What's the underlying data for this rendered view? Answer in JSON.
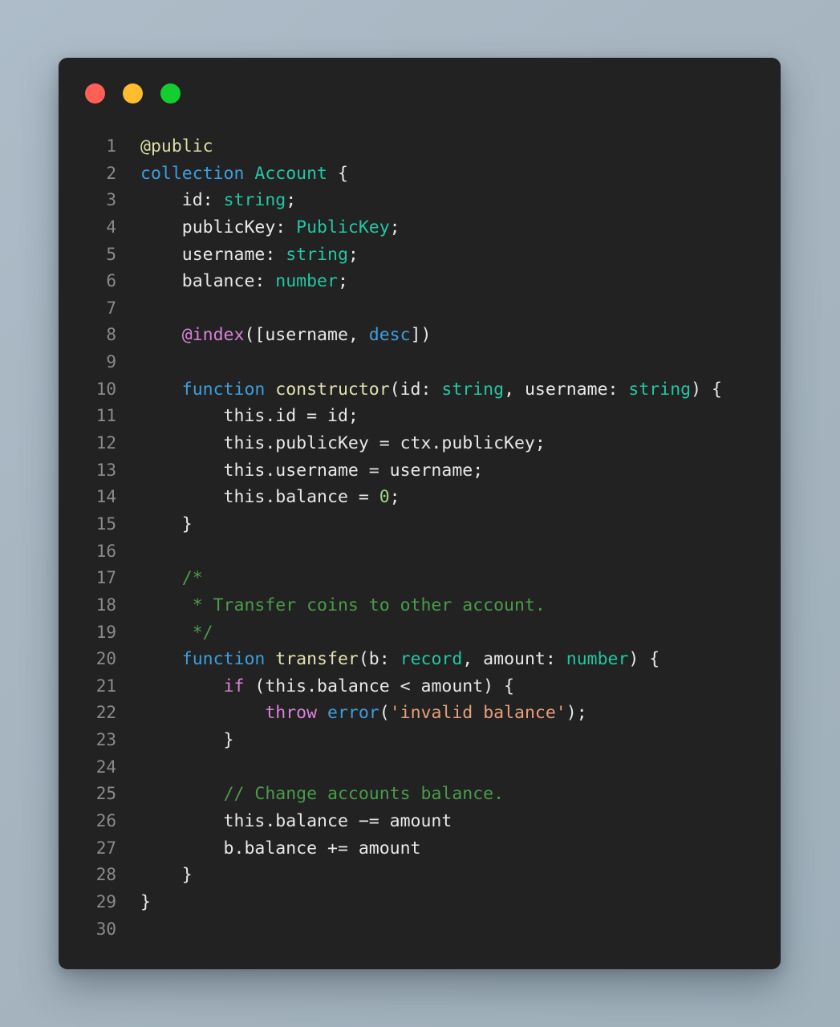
{
  "window": {
    "background_color": "#222222",
    "page_background_color": "#a8b6c2",
    "traffic_lights": [
      {
        "name": "close",
        "color": "#ff5f56"
      },
      {
        "name": "minimize",
        "color": "#ffbd2e"
      },
      {
        "name": "maximize",
        "color": "#13ce2f"
      }
    ]
  },
  "editor": {
    "language": "polylang",
    "total_lines": 30,
    "colors": {
      "plain": "#e8e8e8",
      "decorator": "#dcdcaa",
      "annotation": "#d782d9",
      "keyword": "#3d9ede",
      "control": "#d782d9",
      "type": "#23c6a4",
      "function": "#e2e2b0",
      "builtin": "#3d9ede",
      "string": "#e6a07a",
      "number": "#9fd18c",
      "comment": "#4a9c4a",
      "gutter": "#8b8b8b"
    },
    "lines": [
      {
        "num": "1",
        "tokens": [
          {
            "t": "@public",
            "c": "decor"
          }
        ]
      },
      {
        "num": "2",
        "tokens": [
          {
            "t": "collection ",
            "c": "keyword"
          },
          {
            "t": "Account",
            "c": "type"
          },
          {
            "t": " {",
            "c": "plain"
          }
        ]
      },
      {
        "num": "3",
        "tokens": [
          {
            "t": "    id: ",
            "c": "plain"
          },
          {
            "t": "string",
            "c": "type"
          },
          {
            "t": ";",
            "c": "plain"
          }
        ]
      },
      {
        "num": "4",
        "tokens": [
          {
            "t": "    publicKey: ",
            "c": "plain"
          },
          {
            "t": "PublicKey",
            "c": "type"
          },
          {
            "t": ";",
            "c": "plain"
          }
        ]
      },
      {
        "num": "5",
        "tokens": [
          {
            "t": "    username: ",
            "c": "plain"
          },
          {
            "t": "string",
            "c": "type"
          },
          {
            "t": ";",
            "c": "plain"
          }
        ]
      },
      {
        "num": "6",
        "tokens": [
          {
            "t": "    balance: ",
            "c": "plain"
          },
          {
            "t": "number",
            "c": "type"
          },
          {
            "t": ";",
            "c": "plain"
          }
        ]
      },
      {
        "num": "7",
        "tokens": []
      },
      {
        "num": "8",
        "tokens": [
          {
            "t": "    ",
            "c": "plain"
          },
          {
            "t": "@index",
            "c": "annot"
          },
          {
            "t": "([username, ",
            "c": "plain"
          },
          {
            "t": "desc",
            "c": "keyword"
          },
          {
            "t": "])",
            "c": "plain"
          }
        ]
      },
      {
        "num": "9",
        "tokens": []
      },
      {
        "num": "10",
        "tokens": [
          {
            "t": "    ",
            "c": "plain"
          },
          {
            "t": "function ",
            "c": "keyword"
          },
          {
            "t": "constructor",
            "c": "func"
          },
          {
            "t": "(id: ",
            "c": "plain"
          },
          {
            "t": "string",
            "c": "type"
          },
          {
            "t": ", username: ",
            "c": "plain"
          },
          {
            "t": "string",
            "c": "type"
          },
          {
            "t": ") {",
            "c": "plain"
          }
        ]
      },
      {
        "num": "11",
        "tokens": [
          {
            "t": "        this.id = id;",
            "c": "plain"
          }
        ]
      },
      {
        "num": "12",
        "tokens": [
          {
            "t": "        this.publicKey = ctx.publicKey;",
            "c": "plain"
          }
        ]
      },
      {
        "num": "13",
        "tokens": [
          {
            "t": "        this.username = username;",
            "c": "plain"
          }
        ]
      },
      {
        "num": "14",
        "tokens": [
          {
            "t": "        this.balance = ",
            "c": "plain"
          },
          {
            "t": "0",
            "c": "number"
          },
          {
            "t": ";",
            "c": "plain"
          }
        ]
      },
      {
        "num": "15",
        "tokens": [
          {
            "t": "    }",
            "c": "plain"
          }
        ]
      },
      {
        "num": "16",
        "tokens": []
      },
      {
        "num": "17",
        "tokens": [
          {
            "t": "    /*",
            "c": "comment"
          }
        ]
      },
      {
        "num": "18",
        "tokens": [
          {
            "t": "     * Transfer coins to other account.",
            "c": "comment"
          }
        ]
      },
      {
        "num": "19",
        "tokens": [
          {
            "t": "     */",
            "c": "comment"
          }
        ]
      },
      {
        "num": "20",
        "tokens": [
          {
            "t": "    ",
            "c": "plain"
          },
          {
            "t": "function ",
            "c": "keyword"
          },
          {
            "t": "transfer",
            "c": "func"
          },
          {
            "t": "(b: ",
            "c": "plain"
          },
          {
            "t": "record",
            "c": "type"
          },
          {
            "t": ", amount: ",
            "c": "plain"
          },
          {
            "t": "number",
            "c": "type"
          },
          {
            "t": ") {",
            "c": "plain"
          }
        ]
      },
      {
        "num": "21",
        "tokens": [
          {
            "t": "        ",
            "c": "plain"
          },
          {
            "t": "if",
            "c": "ctrl"
          },
          {
            "t": " (this.balance < amount) {",
            "c": "plain"
          }
        ]
      },
      {
        "num": "22",
        "tokens": [
          {
            "t": "            ",
            "c": "plain"
          },
          {
            "t": "throw ",
            "c": "ctrl"
          },
          {
            "t": "error",
            "c": "builtin"
          },
          {
            "t": "(",
            "c": "plain"
          },
          {
            "t": "'invalid balance'",
            "c": "string"
          },
          {
            "t": ");",
            "c": "plain"
          }
        ]
      },
      {
        "num": "23",
        "tokens": [
          {
            "t": "        }",
            "c": "plain"
          }
        ]
      },
      {
        "num": "24",
        "tokens": []
      },
      {
        "num": "25",
        "tokens": [
          {
            "t": "        ",
            "c": "plain"
          },
          {
            "t": "// Change accounts balance.",
            "c": "comment"
          }
        ]
      },
      {
        "num": "26",
        "tokens": [
          {
            "t": "        this.balance −= amount",
            "c": "plain"
          }
        ]
      },
      {
        "num": "27",
        "tokens": [
          {
            "t": "        b.balance += amount",
            "c": "plain"
          }
        ]
      },
      {
        "num": "28",
        "tokens": [
          {
            "t": "    }",
            "c": "plain"
          }
        ]
      },
      {
        "num": "29",
        "tokens": [
          {
            "t": "}",
            "c": "plain"
          }
        ]
      },
      {
        "num": "30",
        "tokens": []
      }
    ]
  }
}
